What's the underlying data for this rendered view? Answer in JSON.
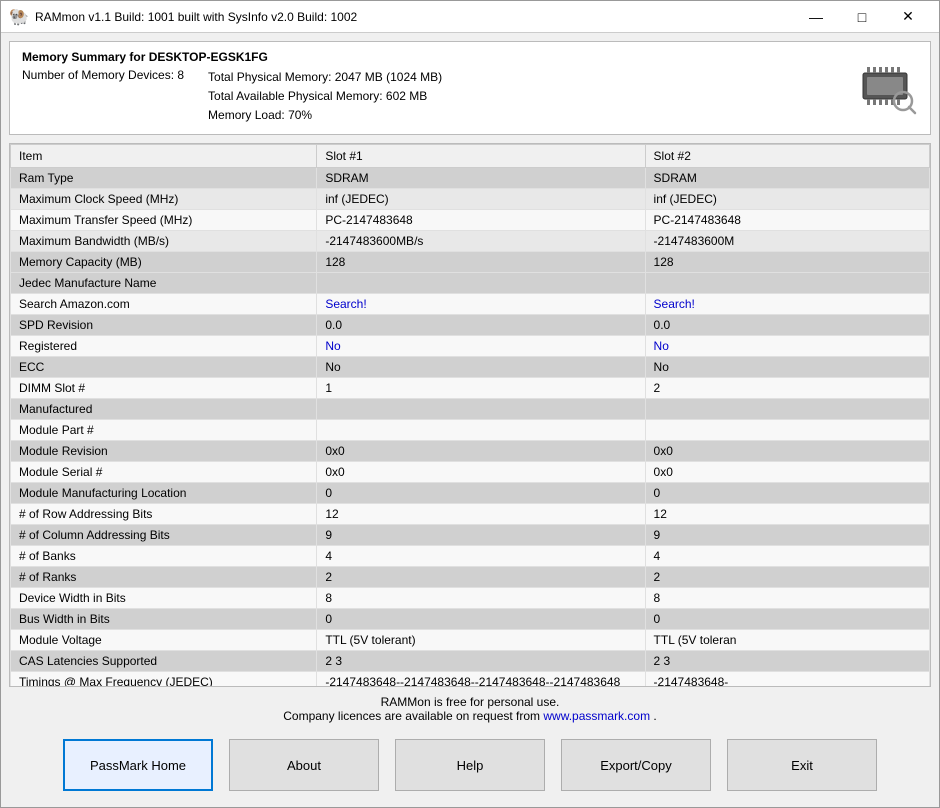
{
  "titleBar": {
    "icon": "🐏",
    "title": "RAMmon v1.1 Build: 1001 built with SysInfo v2.0 Build: 1002",
    "minimize": "—",
    "maximize": "□",
    "close": "✕"
  },
  "memorySummary": {
    "title": "Memory Summary for DESKTOP-EGSK1FG",
    "devices": "Number of Memory Devices: 8",
    "lines": [
      "Total Physical Memory: 2047 MB (1024 MB)",
      "Total Available Physical Memory: 602 MB",
      "Memory Load: 70%"
    ]
  },
  "table": {
    "headers": [
      "Item",
      "Slot #1",
      "Slot #2"
    ],
    "rows": [
      {
        "type": "section",
        "item": "Ram Type",
        "slot1": "SDRAM",
        "slot2": "SDRAM"
      },
      {
        "type": "data",
        "item": "    Maximum Clock Speed (MHz)",
        "slot1": "inf (JEDEC)",
        "slot2": "inf (JEDEC)"
      },
      {
        "type": "data",
        "item": "    Maximum Transfer Speed (MHz)",
        "slot1": "PC-2147483648",
        "slot2": "PC-2147483648"
      },
      {
        "type": "data",
        "item": "    Maximum Bandwidth (MB/s)",
        "slot1": "-2147483600MB/s",
        "slot2": "-2147483600M"
      },
      {
        "type": "section",
        "item": "Memory Capacity (MB)",
        "slot1": "128",
        "slot2": "128"
      },
      {
        "type": "section",
        "item": "Jedec Manufacture Name",
        "slot1": "",
        "slot2": ""
      },
      {
        "type": "data",
        "item": "Search Amazon.com",
        "slot1": "Search!",
        "slot2": "Search!",
        "link": true
      },
      {
        "type": "section",
        "item": "SPD Revision",
        "slot1": "0.0",
        "slot2": "0.0"
      },
      {
        "type": "data",
        "item": "Registered",
        "slot1": "No",
        "slot2": "No",
        "highlight": true
      },
      {
        "type": "section",
        "item": "ECC",
        "slot1": "No",
        "slot2": "No"
      },
      {
        "type": "data",
        "item": "DIMM Slot #",
        "slot1": "1",
        "slot2": "2"
      },
      {
        "type": "section",
        "item": "Manufactured",
        "slot1": "",
        "slot2": ""
      },
      {
        "type": "data",
        "item": "Module Part #",
        "slot1": "",
        "slot2": ""
      },
      {
        "type": "section",
        "item": "Module Revision",
        "slot1": "0x0",
        "slot2": "0x0"
      },
      {
        "type": "data",
        "item": "Module Serial #",
        "slot1": "0x0",
        "slot2": "0x0"
      },
      {
        "type": "section",
        "item": "Module Manufacturing Location",
        "slot1": "0",
        "slot2": "0"
      },
      {
        "type": "data",
        "item": "# of Row Addressing Bits",
        "slot1": "12",
        "slot2": "12"
      },
      {
        "type": "section",
        "item": "# of Column Addressing Bits",
        "slot1": "9",
        "slot2": "9"
      },
      {
        "type": "data",
        "item": "# of Banks",
        "slot1": "4",
        "slot2": "4"
      },
      {
        "type": "section",
        "item": "# of Ranks",
        "slot1": "2",
        "slot2": "2"
      },
      {
        "type": "data",
        "item": "Device Width in Bits",
        "slot1": "8",
        "slot2": "8"
      },
      {
        "type": "section",
        "item": "Bus Width in Bits",
        "slot1": "0",
        "slot2": "0"
      },
      {
        "type": "data",
        "item": "Module Voltage",
        "slot1": "TTL (5V tolerant)",
        "slot2": "TTL (5V toleran"
      },
      {
        "type": "section",
        "item": "CAS Latencies Supported",
        "slot1": "2 3",
        "slot2": "2 3"
      },
      {
        "type": "data",
        "item": "Timings @ Max Frequency (JEDEC)",
        "slot1": "-2147483648--2147483648--2147483648--2147483648",
        "slot2": "-2147483648-"
      }
    ]
  },
  "footer": {
    "line1": "RAMMon is free for personal use.",
    "line2": "Company licences are available on request from ",
    "link": "www.passmark.com",
    "linkSuffix": "."
  },
  "buttons": [
    {
      "label": "PassMark Home",
      "name": "passmark-home-button",
      "active": true
    },
    {
      "label": "About",
      "name": "about-button",
      "active": false
    },
    {
      "label": "Help",
      "name": "help-button",
      "active": false
    },
    {
      "label": "Export/Copy",
      "name": "export-copy-button",
      "active": false
    },
    {
      "label": "Exit",
      "name": "exit-button",
      "active": false
    }
  ]
}
